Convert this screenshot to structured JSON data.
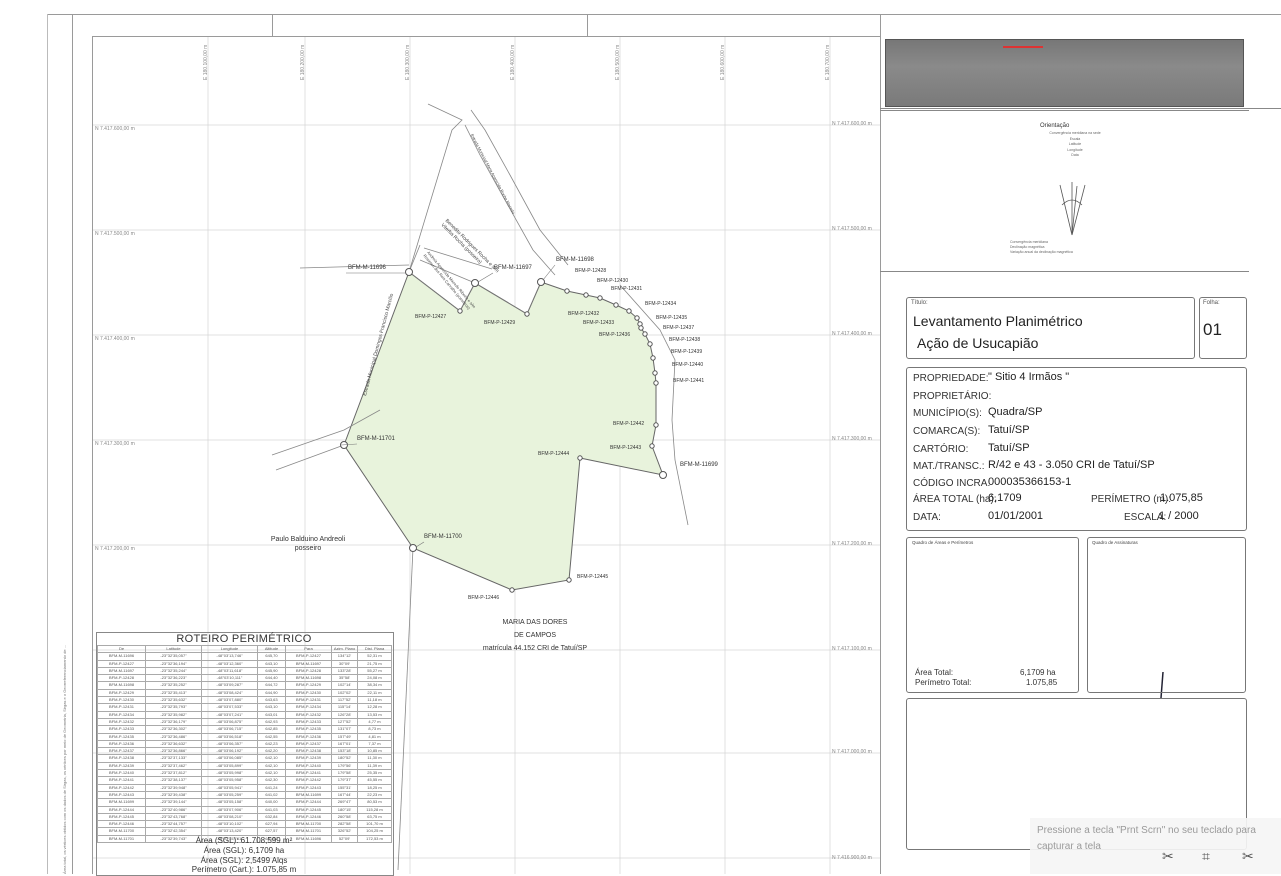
{
  "title_block": {
    "title_label": "Título:",
    "title_line1": "Levantamento Planimétrico",
    "title_line2": "Ação de Usucapião",
    "sheet_label": "Folha:",
    "sheet_number": "01"
  },
  "orientation": {
    "heading": "Orientação",
    "lines": [
      "Convergência meridiana na sede",
      "Escala",
      "Latitude",
      "Longitude",
      "Data"
    ],
    "legend": [
      "Convergência meridiana",
      "Declinação magnética",
      "Variação anual da declinação magnética"
    ]
  },
  "properties": [
    {
      "label": "PROPRIEDADE:",
      "value": "\" Sitio 4 Irmãos \""
    },
    {
      "label": "PROPRIETÁRIO:",
      "value": ""
    },
    {
      "label": "MUNICÍPIO(S):",
      "value": "Quadra/SP"
    },
    {
      "label": "COMARCA(S):",
      "value": "Tatuí/SP"
    },
    {
      "label": "CARTÓRIO:",
      "value": "Tatuí/SP"
    },
    {
      "label": "MAT./TRANSC.:",
      "value": "R/42 e 43 - 3.050 CRI de Tatuí/SP"
    },
    {
      "label": "CÓDIGO INCRA:",
      "value": "000035366153-1"
    }
  ],
  "area_total": {
    "label": "ÁREA TOTAL (ha):",
    "value": "6,1709"
  },
  "perimetro": {
    "label": "PERÍMETRO (m):",
    "value": "1.075,85"
  },
  "data_row": {
    "label": "DATA:",
    "value": "01/01/2001"
  },
  "escala": {
    "label": "ESCALA:",
    "value": "1 / 2000"
  },
  "quadro_areas": {
    "title": "Quadro de Áreas e Perímetros",
    "area_label": "Área Total:",
    "area_value": "6,1709 ha",
    "perim_label": "Perímetro Total:",
    "perim_value": "1.075,85"
  },
  "quadro_assinaturas": {
    "title": "Quadro de Assinaturas"
  },
  "map": {
    "vertices": [
      "BFM-M-11696",
      "BFM-M-11697",
      "BFM-M-11698",
      "BFM-P-12428",
      "BFM-P-12430",
      "BFM-P-12431",
      "BFM-P-12434",
      "BFM-P-12432",
      "BFM-P-12433",
      "BFM-P-12435",
      "BFM-P-12436",
      "BFM-P-12437",
      "BFM-P-12438",
      "BFM-P-12439",
      "BFM-P-12440",
      "BFM-P-12441",
      "BFM-P-12442",
      "BFM-P-12443",
      "BFM-M-11699",
      "BFM-P-12444",
      "BFM-M-11701",
      "BFM-M-11700",
      "BFM-P-12445",
      "BFM-P-12446",
      "BFM-P-12427",
      "BFM-P-12429"
    ],
    "neighbors": {
      "paulo_line1": "Paulo Balduino Andreoli",
      "paulo_line2": "posseiro",
      "maria_line1": "MARIA DAS DORES",
      "maria_line2": "DE CAMPOS",
      "maria_line3": "matrícula 44.152 CRI de Tatuí/SP"
    },
    "roads": {
      "estrada_municipal": "Estrada Municipal Domingos Francisco Marcílio",
      "estrada_right": "Estrada Municipal Maria Aparecida Rocha Macedo",
      "sitio_vitoria": "Benedito Rodrigues Rocha e s/m Viterba Rocha (posseiro)",
      "sitio_lower": "Andreia Aparecida Macedo Ribeiro e s/m Rosimeri dos Reis Carvalho (posseiros)"
    },
    "coords_top": [
      "E 180.100,00 m",
      "E 180.200,00 m",
      "E 180.300,00 m",
      "E 180.400,00 m",
      "E 180.500,00 m",
      "E 180.600,00 m",
      "E 180.700,00 m"
    ],
    "coords_left": [
      "N 7.417.600,00 m",
      "N 7.417.500,00 m",
      "N 7.417.400,00 m",
      "N 7.417.300,00 m",
      "N 7.417.200,00 m"
    ],
    "coords_right": [
      "N 7.417.600,00 m",
      "N 7.417.500,00 m",
      "N 7.417.400,00 m",
      "N 7.417.300,00 m",
      "N 7.417.200,00 m",
      "N 7.417.100,00 m",
      "N 7.417.000,00 m",
      "N 7.416.900,00 m"
    ]
  },
  "roteiro": {
    "title": "ROTEIRO PERIMÉTRICO",
    "headers": [
      "De",
      "Latitude",
      "Longitude",
      "Altitude",
      "Para",
      "Azim. Plano",
      "Dist. Plana"
    ],
    "rows": [
      [
        "BFM-M-11696",
        "-23°32'35,057\"",
        "-48°03'13,746\"",
        "645,70",
        "BFM-P-12427",
        "134°12'",
        "52,31 m"
      ],
      [
        "BFM-P-12427",
        "-23°32'36,194\"",
        "-48°03'12,360\"",
        "643,10",
        "BFM-M-11697",
        "30°09'",
        "21,75 m"
      ],
      [
        "BFM-M-11697",
        "-23°32'35,244\"",
        "-48°03'11,618\"",
        "645,90",
        "BFM-P-12428",
        "133°28'",
        "55,27 m"
      ],
      [
        "BFM-P-12428",
        "-23°32'36,223\"",
        "-48°03'10,111\"",
        "644,40",
        "BFM-M-11698",
        "35°58'",
        "24,08 m"
      ],
      [
        "BFM-M-11698",
        "-23°32'35,252\"",
        "-48°03'09,287\"",
        "644,72",
        "BFM-P-12429",
        "102°14'",
        "38,34 m"
      ],
      [
        "BFM-P-12429",
        "-23°32'35,413\"",
        "-48°03'08,424\"",
        "644,90",
        "BFM-P-12430",
        "102°02'",
        "22,11 m"
      ],
      [
        "BFM-P-12430",
        "-23°32'35,632\"",
        "-48°03'07,880\"",
        "643,63",
        "BFM-P-12431",
        "117°52'",
        "11,18 m"
      ],
      [
        "BFM-P-12431",
        "-23°32'35,793\"",
        "-48°03'07,533\"",
        "643,10",
        "BFM-P-12434",
        "115°14'",
        "12,28 m"
      ],
      [
        "BFM-P-12434",
        "-23°32'35,982\"",
        "-48°03'07,241\"",
        "643,01",
        "BFM-P-12432",
        "126°28'",
        "13,53 m"
      ],
      [
        "BFM-P-12432",
        "-23°32'36,179\"",
        "-48°03'06,875\"",
        "642,93",
        "BFM-P-12433",
        "127°52'",
        "4,77 m"
      ],
      [
        "BFM-P-12433",
        "-23°32'36,302\"",
        "-48°03'06,715\"",
        "642,85",
        "BFM-P-12435",
        "131°07'",
        "8,73 m"
      ],
      [
        "BFM-P-12435",
        "-23°32'36,486\"",
        "-48°03'06,518\"",
        "642,55",
        "BFM-P-12436",
        "157°49'",
        "4,81 m"
      ],
      [
        "BFM-P-12436",
        "-23°32'36,632\"",
        "-48°03'06,357\"",
        "642,23",
        "BFM-P-12437",
        "167°01'",
        "7,37 m"
      ],
      [
        "BFM-P-12437",
        "-23°32'36,866\"",
        "-48°03'06,192\"",
        "642,20",
        "BFM-P-12438",
        "153°18'",
        "10,85 m"
      ],
      [
        "BFM-P-12438",
        "-23°32'37,133\"",
        "-48°03'06,085\"",
        "642,10",
        "BFM-P-12439",
        "180°52'",
        "11,30 m"
      ],
      [
        "BFM-P-12439",
        "-23°32'37,462\"",
        "-48°03'05,899\"",
        "642,10",
        "BFM-P-12440",
        "179°56'",
        "11,39 m"
      ],
      [
        "BFM-P-12440",
        "-23°32'37,812\"",
        "-48°03'05,998\"",
        "642,10",
        "BFM-P-12441",
        "179°58'",
        "25,35 m"
      ],
      [
        "BFM-P-12441",
        "-23°32'38,137\"",
        "-48°03'05,958\"",
        "642,30",
        "BFM-P-12442",
        "179°37'",
        "45,55 m"
      ],
      [
        "BFM-P-12442",
        "-23°32'39,948\"",
        "-48°03'05,941\"",
        "641,24",
        "BFM-P-12443",
        "155°31'",
        "18,25 m"
      ],
      [
        "BFM-P-12443",
        "-23°32'39,438\"",
        "-48°03'05,259\"",
        "641,02",
        "BFM-M-11699",
        "167°44'",
        "22,23 m"
      ],
      [
        "BFM-M-11699",
        "-23°32'39,144\"",
        "-48°03'05,158\"",
        "640,00",
        "BFM-P-12444",
        "269°47'",
        "80,53 m"
      ],
      [
        "BFM-P-12444",
        "-23°32'40,986\"",
        "-48°03'07,906\"",
        "641,03",
        "BFM-P-12445",
        "180°15'",
        "115,28 m"
      ],
      [
        "BFM-P-12445",
        "-23°32'43,768\"",
        "-48°03'08,210\"",
        "632,84",
        "BFM-P-12446",
        "260°58'",
        "63,75 m"
      ],
      [
        "BFM-P-12446",
        "-23°32'44,757\"",
        "-48°03'10,102\"",
        "627,94",
        "BFM-M-11700",
        "282°58'",
        "101,70 m"
      ],
      [
        "BFM-M-11700",
        "-23°32'42,354\"",
        "-48°03'13,420\"",
        "627,57",
        "BFM-M-11701",
        "326°52'",
        "104,25 m"
      ],
      [
        "BFM-M-11701",
        "-23°32'39,743\"",
        "-48°03'15,781\"",
        "631,52",
        "BFM-M-11696",
        "52°09'",
        "172,53 m"
      ]
    ],
    "area_sgl_m2": "Área (SGL): 61.708,599 m²",
    "area_sgl_ha": "Área (SGL): 6,1709 ha",
    "area_sgl_alq": "Área (SGL): 2,5499 Alqs",
    "perimetro_cart": "Perímetro (Cart.): 1.075,85 m"
  },
  "side_note": "Área total, os vértices obtidos com os dados de Sirgas, os vértices por meio de Geometria, Sirgas e o Georreferenciamento de ...",
  "toast": {
    "text": "Pressione a tecla \"Prnt Scrn\" no seu teclado para capturar a tela",
    "icons": [
      "snip-icon",
      "crop-icon",
      "snip-icon"
    ]
  },
  "colors": {
    "polygon_fill": "#e8f3dc",
    "line": "#666666",
    "frame": "#9a9a9a"
  }
}
